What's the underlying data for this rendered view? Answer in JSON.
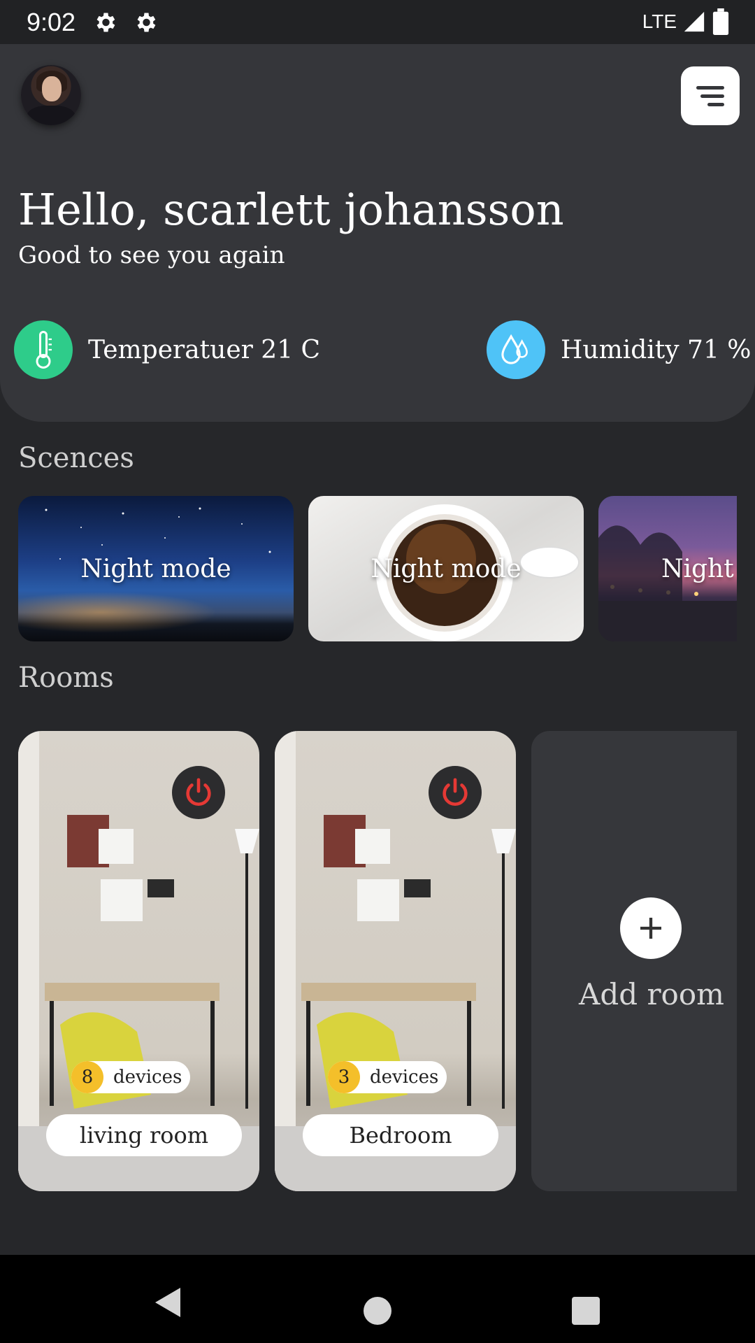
{
  "status_bar": {
    "time": "9:02",
    "network": "LTE",
    "icons": [
      "gear-icon",
      "gear-icon",
      "signal-icon",
      "battery-icon"
    ]
  },
  "header": {
    "greeting": "Hello, scarlett johansson",
    "subgreeting": "Good to see you again",
    "menu_icon": "menu-icon"
  },
  "stats": {
    "temperature": {
      "label": "Temperatuer 21 C",
      "icon": "thermometer-icon",
      "color": "#2ecc8a"
    },
    "humidity": {
      "label": "Humidity 71 %",
      "icon": "water-drop-icon",
      "color": "#4fc3f7"
    }
  },
  "scenes": {
    "title": "Scences",
    "items": [
      {
        "label": "Night mode"
      },
      {
        "label": "Night mode"
      },
      {
        "label": "Night"
      }
    ]
  },
  "rooms": {
    "title": "Rooms",
    "items": [
      {
        "name": "living room",
        "device_count": "8",
        "devices_label": "devices"
      },
      {
        "name": "Bedroom",
        "device_count": "3",
        "devices_label": "devices"
      }
    ],
    "add_label": "Add room"
  },
  "colors": {
    "accent_yellow": "#f4bf2a",
    "power_red": "#e53935",
    "background": "#26272a",
    "panel": "#35363a"
  }
}
